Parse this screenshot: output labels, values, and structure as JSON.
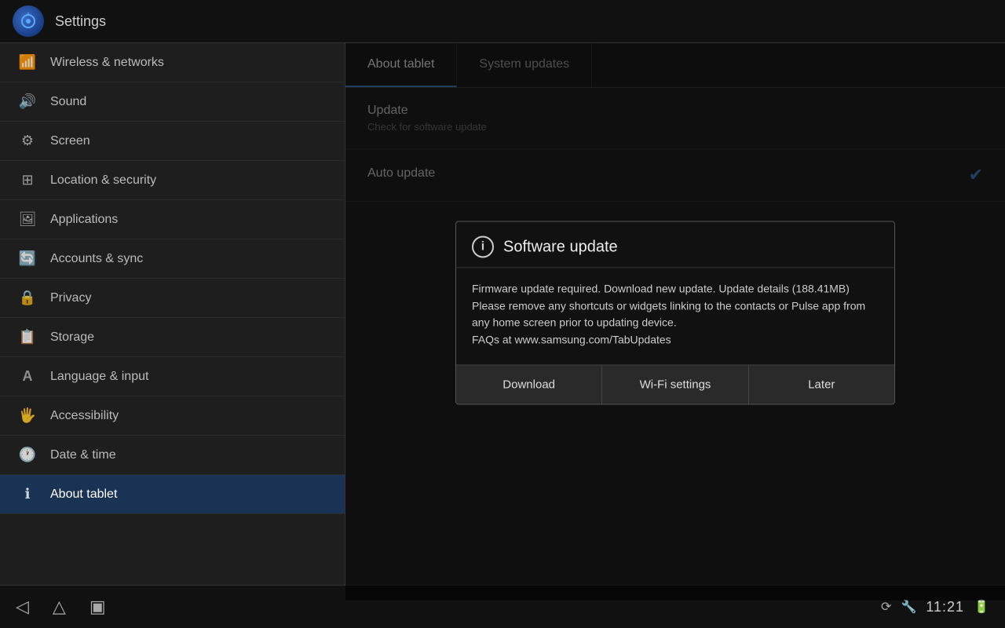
{
  "app": {
    "title": "Settings"
  },
  "topbar": {
    "title": "Settings"
  },
  "sidebar": {
    "items": [
      {
        "id": "wireless",
        "label": "Wireless & networks",
        "icon": "📶"
      },
      {
        "id": "sound",
        "label": "Sound",
        "icon": "🔊"
      },
      {
        "id": "screen",
        "label": "Screen",
        "icon": "⚙"
      },
      {
        "id": "location",
        "label": "Location & security",
        "icon": "⊞"
      },
      {
        "id": "applications",
        "label": "Applications",
        "icon": "🖼"
      },
      {
        "id": "accounts",
        "label": "Accounts & sync",
        "icon": "🔄"
      },
      {
        "id": "privacy",
        "label": "Privacy",
        "icon": "🔒"
      },
      {
        "id": "storage",
        "label": "Storage",
        "icon": "📋"
      },
      {
        "id": "language",
        "label": "Language & input",
        "icon": "A"
      },
      {
        "id": "accessibility",
        "label": "Accessibility",
        "icon": "🖐"
      },
      {
        "id": "datetime",
        "label": "Date & time",
        "icon": "🕐"
      },
      {
        "id": "about",
        "label": "About tablet",
        "icon": "ℹ"
      }
    ]
  },
  "content": {
    "tabs": [
      {
        "id": "about-tablet",
        "label": "About tablet",
        "active": true
      },
      {
        "id": "system-updates",
        "label": "System updates",
        "active": false
      }
    ],
    "rows": [
      {
        "id": "update",
        "title": "Update",
        "subtitle": "Check for software update",
        "hasCheck": false
      },
      {
        "id": "auto-update",
        "title": "Auto update",
        "subtitle": "",
        "hasCheck": true
      }
    ]
  },
  "dialog": {
    "title": "Software update",
    "body": "Firmware update required. Download new update. Update details (188.41MB)\nPlease remove any shortcuts or widgets linking to the contacts or Pulse app from any home screen prior to updating device.\nFAQs at www.samsung.com/TabUpdates",
    "buttons": [
      {
        "id": "download",
        "label": "Download"
      },
      {
        "id": "wifi-settings",
        "label": "Wi-Fi settings"
      },
      {
        "id": "later",
        "label": "Later"
      }
    ]
  },
  "bottombar": {
    "clock": "11:21",
    "nav": {
      "back": "◁",
      "home": "△",
      "recents": "□"
    }
  }
}
